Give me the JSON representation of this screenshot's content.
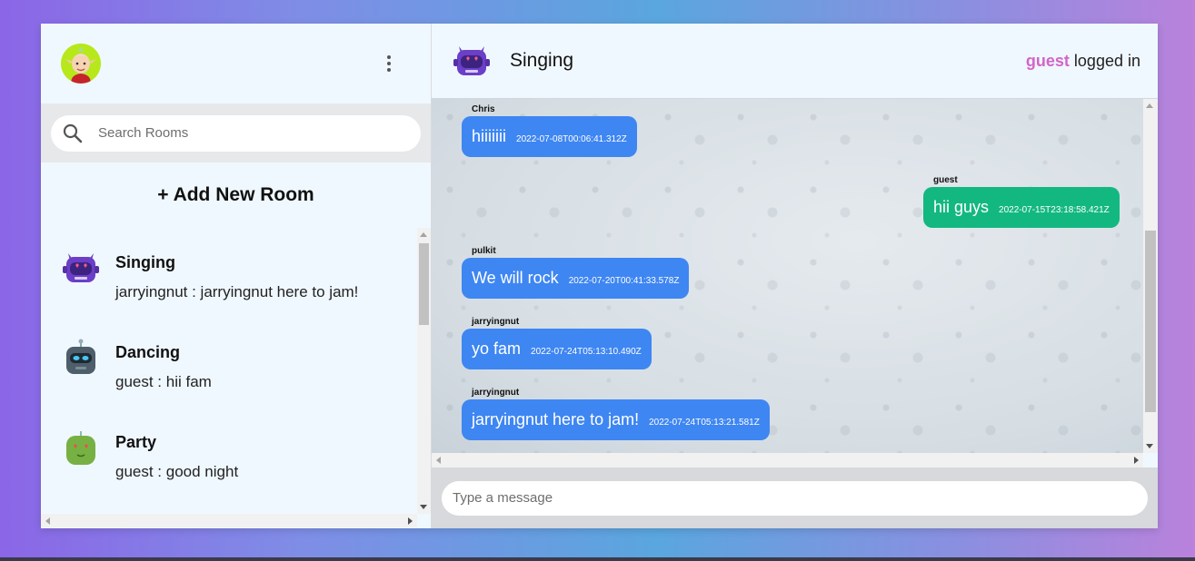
{
  "sidebar": {
    "user_avatar_icon": "elf-avatar-icon",
    "menu_icon": "more-vertical-icon",
    "search": {
      "placeholder": "Search Rooms",
      "icon": "search-icon"
    },
    "add_room_label": "+ Add New Room",
    "rooms": [
      {
        "name": "Singing",
        "last_message": "jarryingnut : jarryingnut here to jam!",
        "icon": "purple-robot-icon"
      },
      {
        "name": "Dancing",
        "last_message": "guest : hii fam",
        "icon": "grey-robot-icon"
      },
      {
        "name": "Party",
        "last_message": "guest : good night",
        "icon": "green-robot-icon"
      }
    ]
  },
  "chat": {
    "room_name": "Singing",
    "room_icon": "purple-robot-icon",
    "current_user": "guest",
    "status_text": "logged in",
    "messages": [
      {
        "author": "Chris",
        "text": "hiiiiiii",
        "time": "2022-07-08T00:06:41.312Z",
        "own": false
      },
      {
        "author": "guest",
        "text": "hii guys",
        "time": "2022-07-15T23:18:58.421Z",
        "own": true
      },
      {
        "author": "pulkit",
        "text": "We will rock",
        "time": "2022-07-20T00:41:33.578Z",
        "own": false
      },
      {
        "author": "jarryingnut",
        "text": "yo fam",
        "time": "2022-07-24T05:13:10.490Z",
        "own": false
      },
      {
        "author": "jarryingnut",
        "text": "jarryingnut here to jam!",
        "time": "2022-07-24T05:13:21.581Z",
        "own": false
      }
    ],
    "input_placeholder": "Type a message"
  },
  "colors": {
    "own_bubble": "#13b881",
    "other_bubble": "#3e86f2",
    "username_accent": "#d365c8"
  }
}
